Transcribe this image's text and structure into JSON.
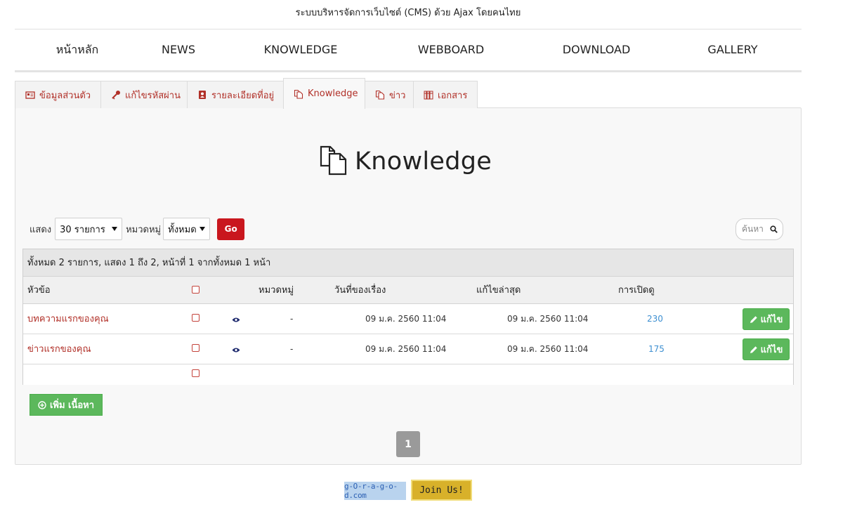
{
  "site": {
    "title": "ระบบบริหารจัดการเว็บไซต์ (CMS) ด้วย Ajax โดยคนไทย"
  },
  "nav": {
    "items": [
      "หน้าหลัก",
      "NEWS",
      "KNOWLEDGE",
      "WEBBOARD",
      "DOWNLOAD",
      "GALLERY"
    ]
  },
  "tabs": [
    {
      "label": "ข้อมูลส่วนตัว",
      "icon": "id-card-icon"
    },
    {
      "label": "แก้ไขรหัสผ่าน",
      "icon": "key-icon"
    },
    {
      "label": "รายละเอียดที่อยู่",
      "icon": "address-book-icon"
    },
    {
      "label": "Knowledge",
      "icon": "documents-icon"
    },
    {
      "label": "ข่าว",
      "icon": "documents-icon"
    },
    {
      "label": "เอกสาร",
      "icon": "folders-icon"
    }
  ],
  "active_tab": "Knowledge",
  "page": {
    "heading": "Knowledge"
  },
  "filters": {
    "show_label": "แสดง",
    "show_value": "30 รายการ",
    "category_label": "หมวดหมู่",
    "category_value": "ทั้งหมด",
    "go_label": "Go",
    "search_placeholder": "ค้นหา"
  },
  "table": {
    "summary": "ทั้งหมด 2 รายการ, แสดง 1 ถึง 2, หน้าที่ 1 จากทั้งหมด 1 หน้า",
    "headers": {
      "title": "หัวข้อ",
      "category": "หมวดหมู่",
      "date": "วันที่ของเรื่อง",
      "updated": "แก้ไขล่าสุด",
      "views": "การเปิดดู"
    },
    "rows": [
      {
        "title": "บทความแรกของคุณ",
        "category": "-",
        "date": "09 ม.ค. 2560 11:04",
        "updated": "09 ม.ค. 2560 11:04",
        "views": "230",
        "edit_label": "แก้ไข"
      },
      {
        "title": "ข่าวแรกของคุณ",
        "category": "-",
        "date": "09 ม.ค. 2560 11:04",
        "updated": "09 ม.ค. 2560 11:04",
        "views": "175",
        "edit_label": "แก้ไข"
      }
    ]
  },
  "actions": {
    "add_label": "เพิ่ม เนื้อหา"
  },
  "pagination": {
    "current": "1"
  },
  "footer": {
    "logo_text": "g-O-r-a-g-o-d.com",
    "join_label": "Join Us!"
  },
  "colors": {
    "accent_red": "#b13028",
    "go_red": "#c9171e",
    "success_green": "#5cb85c",
    "link_blue": "#3d8fd1"
  }
}
